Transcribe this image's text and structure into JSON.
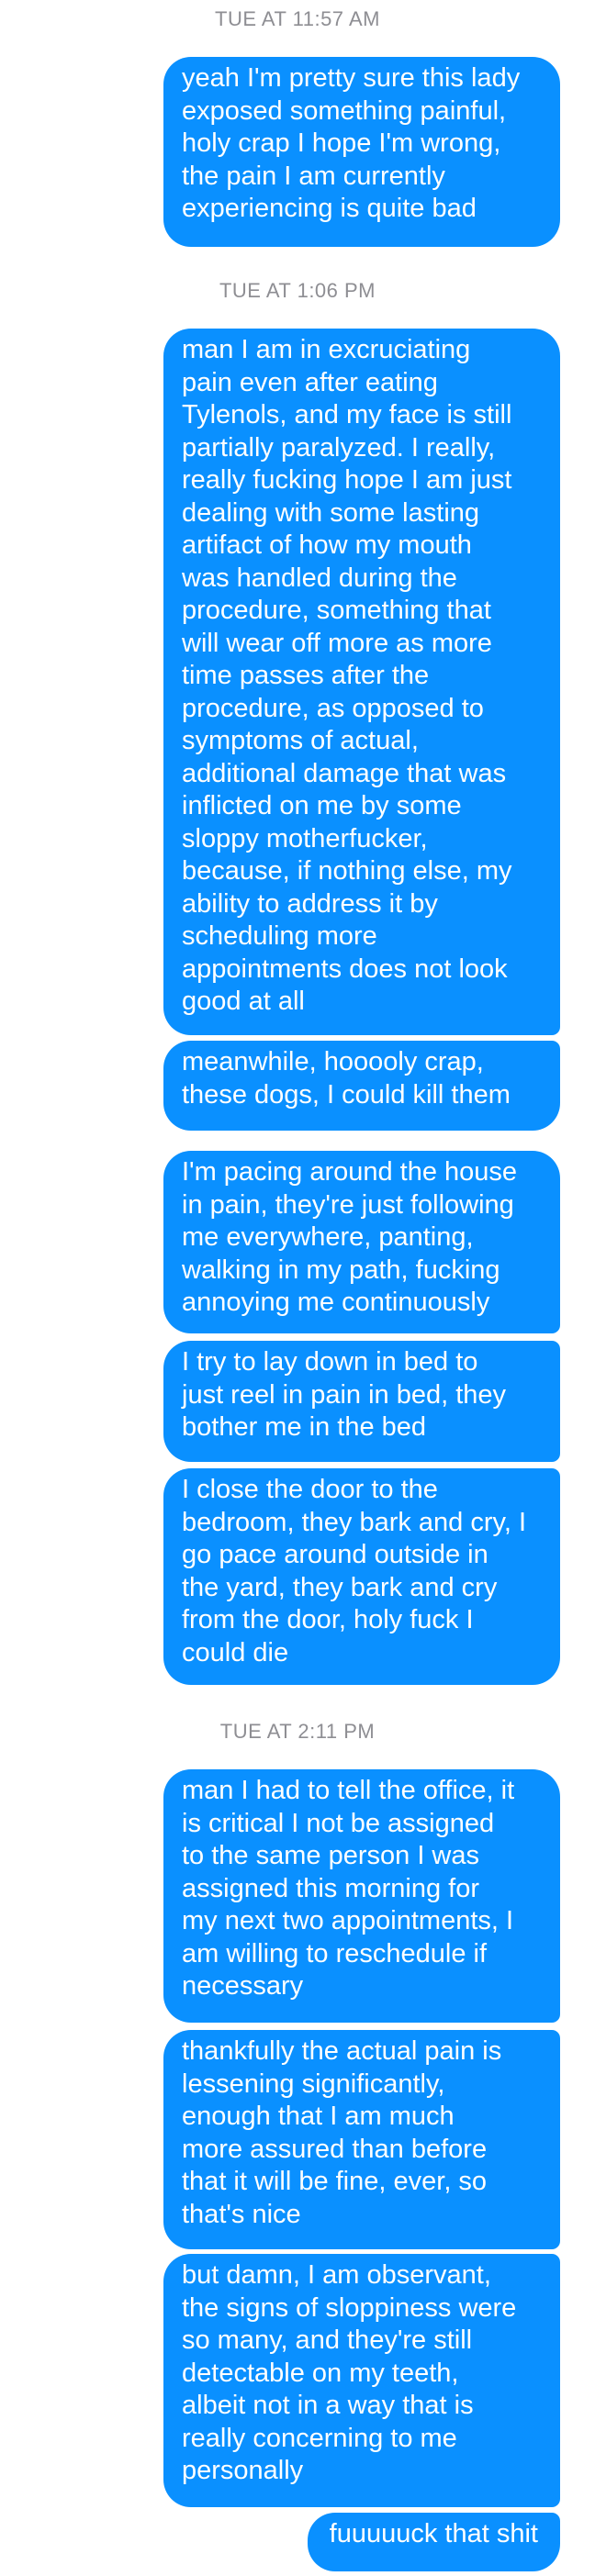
{
  "thread": {
    "timestamps": [
      "TUE AT 11:57 AM",
      "TUE AT 1:06 PM",
      "TUE AT 2:11 PM"
    ],
    "messages": [
      "yeah I'm pretty sure this lady\nexposed something painful,\nholy crap I hope I'm wrong,\nthe pain I am currently\nexperiencing is quite bad",
      "man I am in excruciating\npain even after eating\nTylenols, and my face is still\npartially paralyzed. I really,\nreally fucking hope I am just\ndealing with some lasting\nartifact of how my mouth\nwas handled during the\nprocedure, something that\nwill wear off more as more\ntime passes after the\nprocedure, as opposed to\nsymptoms of actual,\nadditional damage that was\ninflicted on me by some\nsloppy motherfucker,\nbecause, if nothing else, my\nability to address it by\nscheduling more\nappointments does not look\ngood at all",
      "meanwhile, hooooly crap,\nthese dogs, I could kill them",
      "I'm pacing around the house\nin pain, they're just following\nme everywhere, panting,\nwalking in my path, fucking\nannoying me continuously",
      "I try to lay down in bed to\njust reel in pain in bed, they\nbother me in the bed",
      "I close the door to the\nbedroom, they bark and cry, I\ngo pace around outside in\nthe yard, they bark and cry\nfrom the door, holy fuck I\ncould die",
      "man I had to tell the office, it\nis critical I not be assigned\nto the same person I was\nassigned this morning for\nmy next two appointments, I\nam willing to reschedule if\nnecessary",
      "thankfully the actual pain is\nlessening significantly,\nenough that I am much\nmore assured than before\nthat it will be fine, ever, so\nthat's nice",
      "but damn, I am observant,\nthe signs of sloppiness were\nso many, and they're still\ndetectable on my teeth,\nalbeit not in a way that is\nreally concerning to me\npersonally",
      "fuuuuuck that shit"
    ]
  }
}
